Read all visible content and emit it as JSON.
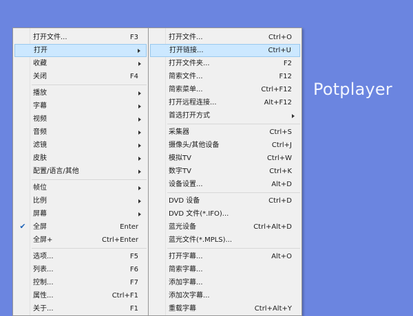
{
  "brand": "Potplayer",
  "main_menu": [
    {
      "label": "打开文件...",
      "shortcut": "F3"
    },
    {
      "label": "打开",
      "arrow": true,
      "highlight": true
    },
    {
      "label": "收藏",
      "arrow": true
    },
    {
      "label": "关闭",
      "shortcut": "F4"
    },
    {
      "sep": true
    },
    {
      "label": "播放",
      "arrow": true
    },
    {
      "label": "字幕",
      "arrow": true
    },
    {
      "label": "视频",
      "arrow": true
    },
    {
      "label": "音频",
      "arrow": true
    },
    {
      "label": "滤镜",
      "arrow": true
    },
    {
      "label": "皮肤",
      "arrow": true
    },
    {
      "label": "配置/语言/其他",
      "arrow": true
    },
    {
      "sep": true
    },
    {
      "label": "帧位",
      "arrow": true
    },
    {
      "label": "比例",
      "arrow": true
    },
    {
      "label": "屏幕",
      "arrow": true
    },
    {
      "label": "全屏",
      "shortcut": "Enter",
      "checked": true
    },
    {
      "label": "全屏+",
      "shortcut": "Ctrl+Enter"
    },
    {
      "sep": true
    },
    {
      "label": "选项...",
      "shortcut": "F5"
    },
    {
      "label": "列表...",
      "shortcut": "F6"
    },
    {
      "label": "控制...",
      "shortcut": "F7"
    },
    {
      "label": "属性...",
      "shortcut": "Ctrl+F1"
    },
    {
      "label": "关于...",
      "shortcut": "F1"
    }
  ],
  "sub_menu": [
    {
      "label": "打开文件...",
      "shortcut": "Ctrl+O"
    },
    {
      "label": "打开链接...",
      "shortcut": "Ctrl+U",
      "highlight": true
    },
    {
      "label": "打开文件夹...",
      "shortcut": "F2"
    },
    {
      "label": "简索文件...",
      "shortcut": "F12"
    },
    {
      "label": "简索菜单...",
      "shortcut": "Ctrl+F12"
    },
    {
      "label": "打开远程连接...",
      "shortcut": "Alt+F12"
    },
    {
      "label": "首选打开方式",
      "arrow": true
    },
    {
      "sep": true
    },
    {
      "label": "采集器",
      "shortcut": "Ctrl+S"
    },
    {
      "label": "摄像头/其他设备",
      "shortcut": "Ctrl+J"
    },
    {
      "label": "模拟TV",
      "shortcut": "Ctrl+W"
    },
    {
      "label": "数字TV",
      "shortcut": "Ctrl+K"
    },
    {
      "label": "设备设置...",
      "shortcut": "Alt+D"
    },
    {
      "sep": true
    },
    {
      "label": "DVD 设备",
      "shortcut": "Ctrl+D"
    },
    {
      "label": "DVD 文件(*.IFO)..."
    },
    {
      "label": "蓝光设备",
      "shortcut": "Ctrl+Alt+D"
    },
    {
      "label": "蓝光文件(*.MPLS)..."
    },
    {
      "sep": true
    },
    {
      "label": "打开字幕...",
      "shortcut": "Alt+O"
    },
    {
      "label": "简索字幕..."
    },
    {
      "label": "添加字幕..."
    },
    {
      "label": "添加次字幕..."
    },
    {
      "label": "重载字幕",
      "shortcut": "Ctrl+Alt+Y"
    }
  ],
  "icons": {
    "checked": "✔"
  }
}
